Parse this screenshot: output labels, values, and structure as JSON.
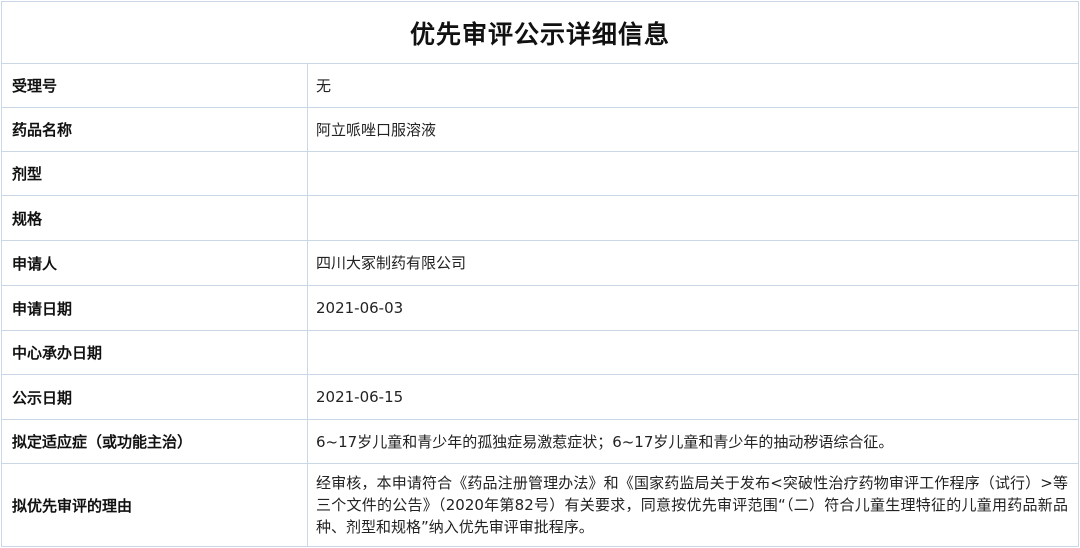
{
  "title": "优先审评公示详细信息",
  "rows": [
    {
      "label": "受理号",
      "value": "无"
    },
    {
      "label": "药品名称",
      "value": "阿立哌唑口服溶液"
    },
    {
      "label": "剂型",
      "value": ""
    },
    {
      "label": "规格",
      "value": ""
    },
    {
      "label": "申请人",
      "value": "四川大冢制药有限公司"
    },
    {
      "label": "申请日期",
      "value": "2021-06-03"
    },
    {
      "label": "中心承办日期",
      "value": ""
    },
    {
      "label": "公示日期",
      "value": "2021-06-15"
    },
    {
      "label": "拟定适应症（或功能主治）",
      "value": "6~17岁儿童和青少年的孤独症易激惹症状；6~17岁儿童和青少年的抽动秽语综合征。"
    },
    {
      "label": "拟优先审评的理由",
      "value": "经审核，本申请符合《药品注册管理办法》和《国家药监局关于发布<突破性治疗药物审评工作程序（试行）>等三个文件的公告》（2020年第82号）有关要求，同意按优先审评范围“（二）符合儿童生理特征的儿童用药品新品种、剂型和规格”纳入优先审评审批程序。"
    }
  ]
}
